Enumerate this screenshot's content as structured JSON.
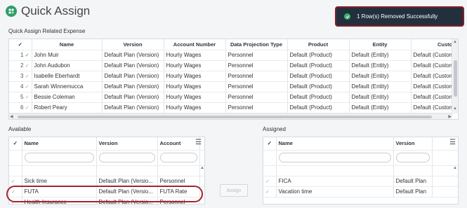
{
  "header": {
    "title": "Quick Assign"
  },
  "toast": {
    "message": "1 Row(s) Removed Successfully"
  },
  "expense": {
    "label": "Quick Assign Related Expense",
    "columns": [
      "Name",
      "Version",
      "Account Number",
      "Data Projection Type",
      "Product",
      "Entity",
      "Custome"
    ],
    "rows": [
      {
        "num": "1",
        "cells": [
          "John Muir",
          "Default Plan (Version)",
          "Hourly Wages",
          "Personnel",
          "Default (Product)",
          "Default (Entity)",
          "Default (Custom"
        ]
      },
      {
        "num": "2",
        "cells": [
          "John Audubon",
          "Default Plan (Version)",
          "Hourly Wages",
          "Personnel",
          "Default (Product)",
          "Default (Entity)",
          "Default (Custom"
        ]
      },
      {
        "num": "3",
        "cells": [
          "Isabelle Eberhardt",
          "Default Plan (Version)",
          "Hourly Wages",
          "Personnel",
          "Default (Product)",
          "Default (Entity)",
          "Default (Custom"
        ]
      },
      {
        "num": "4",
        "cells": [
          "Sarah Winnemucca",
          "Default Plan (Version)",
          "Hourly Wages",
          "Personnel",
          "Default (Product)",
          "Default (Entity)",
          "Default (Custom"
        ]
      },
      {
        "num": "5",
        "cells": [
          "Bessie Coleman",
          "Default Plan (Version)",
          "Hourly Wages",
          "Personnel",
          "Default (Product)",
          "Default (Entity)",
          "Default (Custom"
        ]
      },
      {
        "num": "6",
        "cells": [
          "Robert Peary",
          "Default Plan (Version)",
          "Hourly Wages",
          "Personnel",
          "Default (Product)",
          "Default (Entity)",
          "Default (Custom"
        ]
      }
    ]
  },
  "available": {
    "label": "Available",
    "columns": [
      "Name",
      "Version",
      "Account"
    ],
    "rows": [
      [
        "Sick time",
        "Default Plan (Versio...",
        "Personnel"
      ],
      [
        "FUTA",
        "Default Plan (Versio...",
        "FUTA Rate"
      ],
      [
        "Health Insurance",
        "Default Plan (Versio...",
        "Personnel"
      ]
    ]
  },
  "assigned": {
    "label": "Assigned",
    "columns": [
      "Name",
      "Version"
    ],
    "rows": [
      [
        "FICA",
        "Default Plan"
      ],
      [
        "Vacation time",
        "Default Plan"
      ]
    ]
  },
  "actions": {
    "assign_label": "Assign"
  },
  "icons": {
    "app": "quick-assign-icon",
    "toast": "check-circle-icon",
    "menu": "hamburger-menu-icon"
  },
  "colors": {
    "brand": "#2e9d6a",
    "toast_bg": "#22303d",
    "success": "#3bb36b",
    "highlight": "#a32431"
  }
}
